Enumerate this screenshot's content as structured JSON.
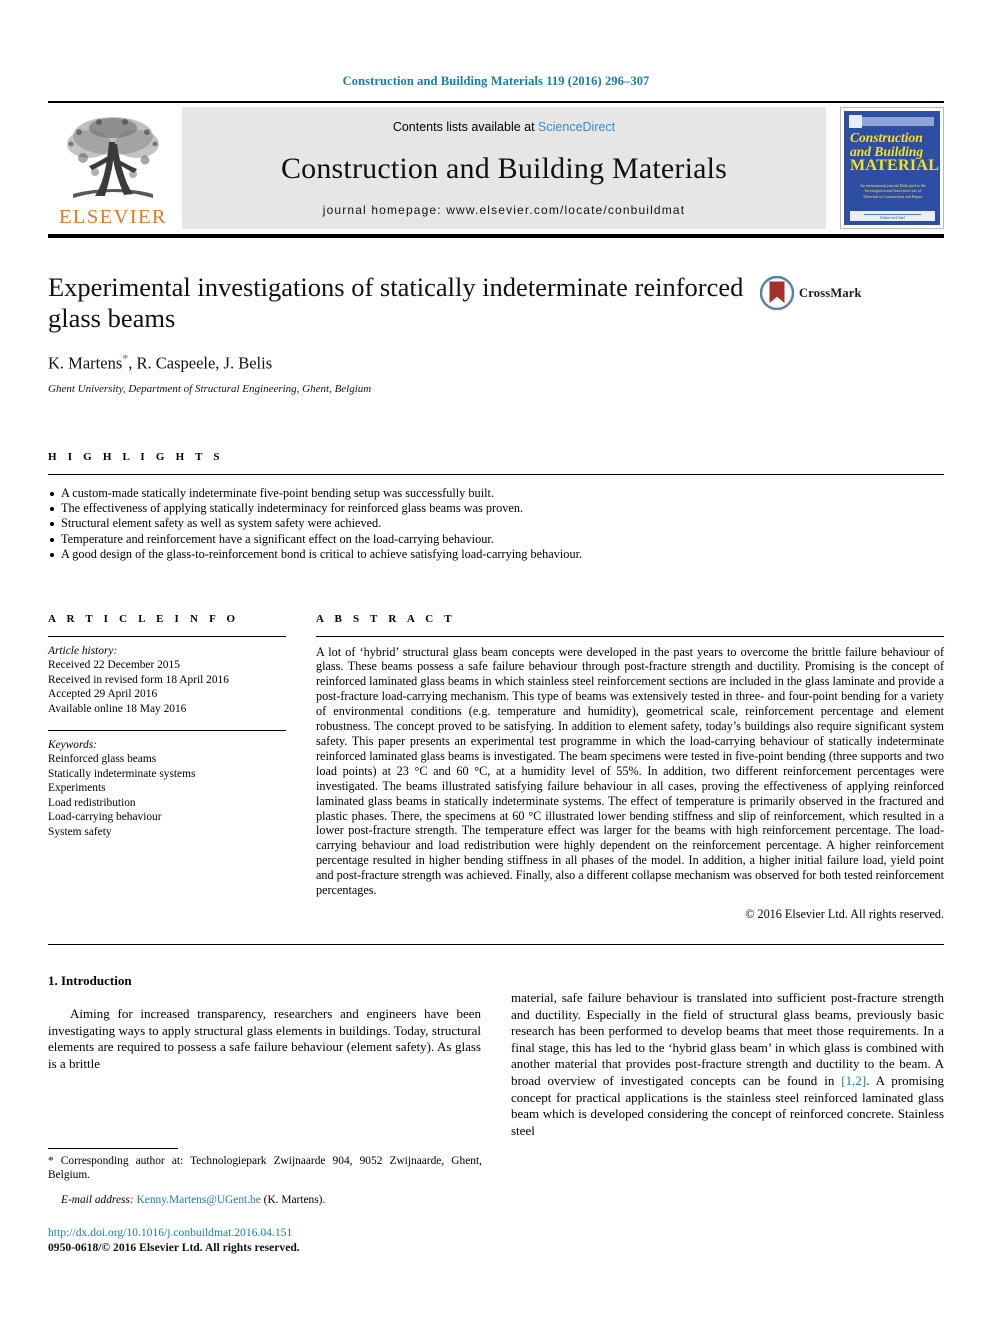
{
  "running_head": "Construction and Building Materials 119 (2016) 296–307",
  "masthead": {
    "publisher_word": "ELSEVIER",
    "contents_prefix": "Contents lists available at ",
    "contents_link": "ScienceDirect",
    "journal_name": "Construction and Building Materials",
    "homepage": "journal homepage: www.elsevier.com/locate/conbuildmat",
    "cover": {
      "title_line1": "Construction",
      "title_line2": "and Building",
      "title_line3": "MATERIALS",
      "subtitle": "An international journal Dedicated to the Investigation and Innovative use of Materials in Construction and Repair",
      "footer": "Editor-in-Chief"
    }
  },
  "article": {
    "title": "Experimental investigations of statically indeterminate reinforced glass beams",
    "authors": "K. Martens",
    "authors_rest": ", R. Caspeele, J. Belis",
    "corresponding_marker": "*",
    "affiliation": "Ghent University, Department of Structural Engineering, Ghent, Belgium",
    "crossmark_label": "CrossMark"
  },
  "highlights": {
    "heading": "H I G H L I G H T S",
    "items": [
      "A custom-made statically indeterminate five-point bending setup was successfully built.",
      "The effectiveness of applying statically indeterminacy for reinforced glass beams was proven.",
      "Structural element safety as well as system safety were achieved.",
      "Temperature and reinforcement have a significant effect on the load-carrying behaviour.",
      "A good design of the glass-to-reinforcement bond is critical to achieve satisfying load-carrying behaviour."
    ]
  },
  "article_info": {
    "heading": "A R T I C L E   I N F O",
    "history_label": "Article history:",
    "history": [
      "Received 22 December 2015",
      "Received in revised form 18 April 2016",
      "Accepted 29 April 2016",
      "Available online 18 May 2016"
    ],
    "keywords_label": "Keywords:",
    "keywords": [
      "Reinforced glass beams",
      "Statically indeterminate systems",
      "Experiments",
      "Load redistribution",
      "Load-carrying behaviour",
      "System safety"
    ]
  },
  "abstract": {
    "heading": "A B S T R A C T",
    "text": "A lot of ‘hybrid’ structural glass beam concepts were developed in the past years to overcome the brittle failure behaviour of glass. These beams possess a safe failure behaviour through post-fracture strength and ductility. Promising is the concept of reinforced laminated glass beams in which stainless steel reinforcement sections are included in the glass laminate and provide a post-fracture load-carrying mechanism. This type of beams was extensively tested in three- and four-point bending for a variety of environmental conditions (e.g. temperature and humidity), geometrical scale, reinforcement percentage and element robustness. The concept proved to be satisfying. In addition to element safety, today’s buildings also require significant system safety. This paper presents an experimental test programme in which the load-carrying behaviour of statically indeterminate reinforced laminated glass beams is investigated. The beam specimens were tested in five-point bending (three supports and two load points) at 23 °C and 60 °C, at a humidity level of 55%. In addition, two different reinforcement percentages were investigated. The beams illustrated satisfying failure behaviour in all cases, proving the effectiveness of applying reinforced laminated glass beams in statically indeterminate systems. The effect of temperature is primarily observed in the fractured and plastic phases. There, the specimens at 60 °C illustrated lower bending stiffness and slip of reinforcement, which resulted in a lower post-fracture strength. The temperature effect was larger for the beams with high reinforcement percentage. The load-carrying behaviour and load redistribution were highly dependent on the reinforcement percentage. A higher reinforcement percentage resulted in higher bending stiffness in all phases of the model. In addition, a higher initial failure load, yield point and post-fracture strength was achieved. Finally, also a different collapse mechanism was observed for both tested reinforcement percentages.",
    "copyright": "© 2016 Elsevier Ltd. All rights reserved."
  },
  "introduction": {
    "heading": "1. Introduction",
    "left_paragraph": "Aiming for increased transparency, researchers and engineers have been investigating ways to apply structural glass elements in buildings. Today, structural elements are required to possess a safe failure behaviour (element safety). As glass is a brittle",
    "right_paragraph_pre": "material, safe failure behaviour is translated into sufficient post-fracture strength and ductility. Especially in the field of structural glass beams, previously basic research has been performed to develop beams that meet those requirements. In a final stage, this has led to the ‘hybrid glass beam’ in which glass is combined with another material that provides post-fracture strength and ductility to the beam. A broad overview of investigated concepts can be found in ",
    "right_reference": "[1,2]",
    "right_paragraph_post": ". A promising concept for practical applications is the stainless steel reinforced laminated glass beam which is developed considering the concept of reinforced concrete. Stainless steel"
  },
  "footnotes": {
    "corresponding_marker": "*",
    "corresponding_text": " Corresponding author at: Technologiepark Zwijnaarde 904, 9052 Zwijnaarde, Ghent, Belgium.",
    "email_label": "E-mail address:",
    "email": "Kenny.Martens@UGent.be",
    "email_suffix": " (K. Martens).",
    "doi": "http://dx.doi.org/10.1016/j.conbuildmat.2016.04.151",
    "issn": "0950-0618/© 2016 Elsevier Ltd. All rights reserved."
  },
  "colors": {
    "link_blue": "#1a7ba8",
    "sciencedirect_blue": "#3b8ac4",
    "elsevier_orange": "#E87722",
    "cover_blue": "#2d4ea2",
    "cover_yellow": "#f5e516",
    "crossmark_red": "#a6302c"
  }
}
